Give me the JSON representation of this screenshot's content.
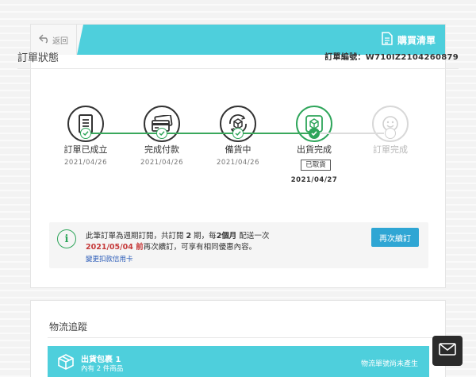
{
  "header": {
    "back_label": "返回",
    "title": "購買清單"
  },
  "order_status": {
    "section_title": "訂單狀態",
    "order_number_label": "訂單編號：",
    "order_number": "W710IZ2104260879"
  },
  "steps": [
    {
      "label": "訂單已成立",
      "date": "2021/04/26",
      "icon": "document-icon",
      "state": "done"
    },
    {
      "label": "完成付款",
      "date": "2021/04/26",
      "icon": "credit-card-icon",
      "state": "done"
    },
    {
      "label": "備貨中",
      "date": "2021/04/26",
      "icon": "box-rotate-icon",
      "state": "done"
    },
    {
      "label": "出貨完成",
      "badge": "已取貨",
      "date": "2021/04/27",
      "icon": "delivery-box-icon",
      "state": "current"
    },
    {
      "label": "訂單完成",
      "icon": "smiley-icon",
      "state": "pending"
    }
  ],
  "notice": {
    "line1_a": "此筆訂單為週期訂閱，共訂閱 ",
    "line1_periods": "2",
    "line1_b": " 期，每",
    "line1_interval": "2個月",
    "line1_c": " 配送一次",
    "line2_date": "2021/05/04 前",
    "line2_rest": "再次續訂，可享有相同優惠內容。",
    "link": "變更扣款信用卡",
    "renew_button": "再次續訂"
  },
  "logistics": {
    "section_title": "物流追蹤",
    "package_title": "出貨包裹 1",
    "package_sub": "內有 2 件商品",
    "package_status": "物流單號尚未產生"
  },
  "colors": {
    "accent": "#4ecfdc",
    "success": "#2ea55a",
    "button": "#2fa6d4",
    "alert": "#c53a3a"
  }
}
